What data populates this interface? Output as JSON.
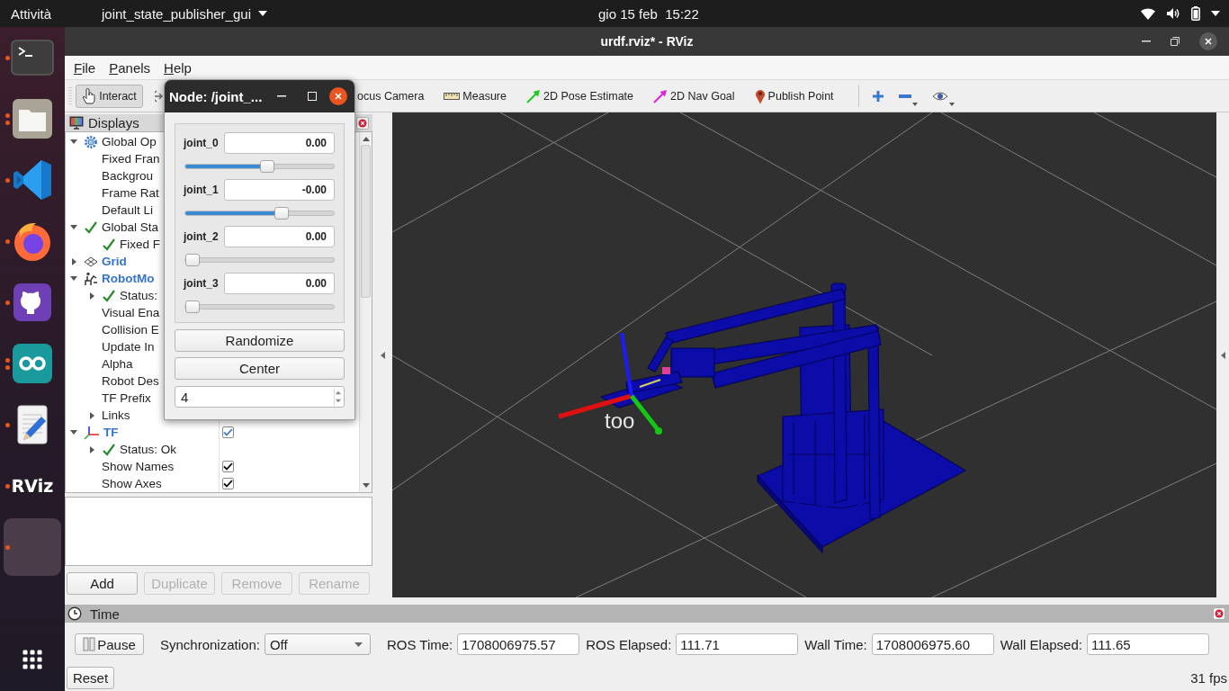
{
  "top_bar": {
    "activities": "Attività",
    "app_menu": "joint_state_publisher_gui",
    "clock": "gio 15 feb  15:22"
  },
  "dock": {
    "items": [
      {
        "kind": "terminal",
        "running": true,
        "multiple_windows": false,
        "selected": false
      },
      {
        "kind": "files",
        "running": true,
        "multiple_windows": true,
        "selected": false
      },
      {
        "kind": "code_editor",
        "running": true,
        "multiple_windows": false,
        "selected": false
      },
      {
        "kind": "browser",
        "running": true,
        "multiple_windows": false,
        "selected": false
      },
      {
        "kind": "git_client",
        "running": true,
        "multiple_windows": false,
        "selected": false
      },
      {
        "kind": "arduino",
        "running": true,
        "multiple_windows": true,
        "selected": false
      },
      {
        "kind": "text_editor",
        "running": true,
        "multiple_windows": false,
        "selected": false
      },
      {
        "kind": "rviz",
        "label": "RViz",
        "running": true,
        "multiple_windows": false,
        "selected": false
      },
      {
        "kind": "blank",
        "running": true,
        "multiple_windows": false,
        "selected": true
      }
    ]
  },
  "window": {
    "title": "urdf.rviz* - RViz"
  },
  "menu": [
    "File",
    "Panels",
    "Help"
  ],
  "toolbar": {
    "tools": [
      {
        "kind": "interact",
        "label": "Interact",
        "selected": true
      },
      {
        "kind": "move_camera",
        "selected": false
      },
      {
        "kind": "focus_camera",
        "label": "ocus Camera",
        "selected": false
      },
      {
        "kind": "measure",
        "label": "Measure",
        "selected": false
      },
      {
        "kind": "pose_estimate",
        "label": "2D Pose Estimate",
        "selected": false
      },
      {
        "kind": "nav_goal",
        "label": "2D Nav Goal",
        "selected": false
      },
      {
        "kind": "publish_point",
        "label": "Publish Point",
        "selected": false
      }
    ],
    "actions": [
      {
        "kind": "add_tool",
        "dropdown": false
      },
      {
        "kind": "remove_tool",
        "dropdown": true
      },
      {
        "kind": "panels",
        "dropdown": true
      }
    ]
  },
  "displays": {
    "title": "Displays",
    "tree": [
      {
        "kind": "global_options",
        "label": "Global Op",
        "expanded": true,
        "children": [
          {
            "kind": "property",
            "label": "Fixed Fran"
          },
          {
            "kind": "property",
            "label": "Backgrou"
          },
          {
            "kind": "property",
            "label": "Frame Rat"
          },
          {
            "kind": "property",
            "label": "Default Li"
          }
        ]
      },
      {
        "kind": "global_status",
        "label": "Global Sta",
        "expanded": true,
        "children": [
          {
            "kind": "status",
            "label": "Fixed F"
          }
        ]
      },
      {
        "kind": "display_grid",
        "label": "Grid",
        "expanded": false
      },
      {
        "kind": "display_robot_model",
        "label": "RobotMo",
        "expanded": true,
        "children": [
          {
            "kind": "status",
            "label": "Status:",
            "expanded": false
          },
          {
            "kind": "property",
            "label": "Visual Ena"
          },
          {
            "kind": "property",
            "label": "Collision E"
          },
          {
            "kind": "property",
            "label": "Update In"
          },
          {
            "kind": "property",
            "label": "Alpha"
          },
          {
            "kind": "property",
            "label": "Robot Des"
          },
          {
            "kind": "property",
            "label": "TF Prefix"
          },
          {
            "kind": "property",
            "label": "Links",
            "expanded": false
          }
        ]
      },
      {
        "kind": "display_tf",
        "label": "TF",
        "expanded": true,
        "checked": true,
        "children": [
          {
            "kind": "status",
            "label": "Status: Ok",
            "expanded": false
          },
          {
            "kind": "property",
            "label": "Show Names",
            "checked": true
          },
          {
            "kind": "property",
            "label": "Show Axes",
            "checked": true
          }
        ]
      }
    ],
    "buttons": [
      {
        "label": "Add",
        "disabled": false
      },
      {
        "label": "Duplicate",
        "disabled": true
      },
      {
        "label": "Remove",
        "disabled": true
      },
      {
        "label": "Rename",
        "disabled": true
      }
    ]
  },
  "viewport": {
    "frame_label": "too"
  },
  "joint_dialog": {
    "title": "Node: /joint_...",
    "joints": [
      {
        "name": "joint_0",
        "value": "0.00",
        "level": 0.5
      },
      {
        "name": "joint_1",
        "value": "-0.00",
        "level": 0.6
      },
      {
        "name": "joint_2",
        "value": "0.00",
        "level": 0
      },
      {
        "name": "joint_3",
        "value": "0.00",
        "level": 0
      }
    ],
    "buttons": [
      "Randomize",
      "Center"
    ],
    "count": "4"
  },
  "time_panel": {
    "title": "Time",
    "pause": "Pause",
    "sync_label": "Synchronization:",
    "sync_value": "Off",
    "fields": [
      {
        "label": "ROS Time:",
        "value": "1708006975.57"
      },
      {
        "label": "ROS Elapsed:",
        "value": "111.71"
      },
      {
        "label": "Wall Time:",
        "value": "1708006975.60"
      },
      {
        "label": "Wall Elapsed:",
        "value": "111.65"
      }
    ],
    "reset": "Reset",
    "fps": "31 fps"
  }
}
